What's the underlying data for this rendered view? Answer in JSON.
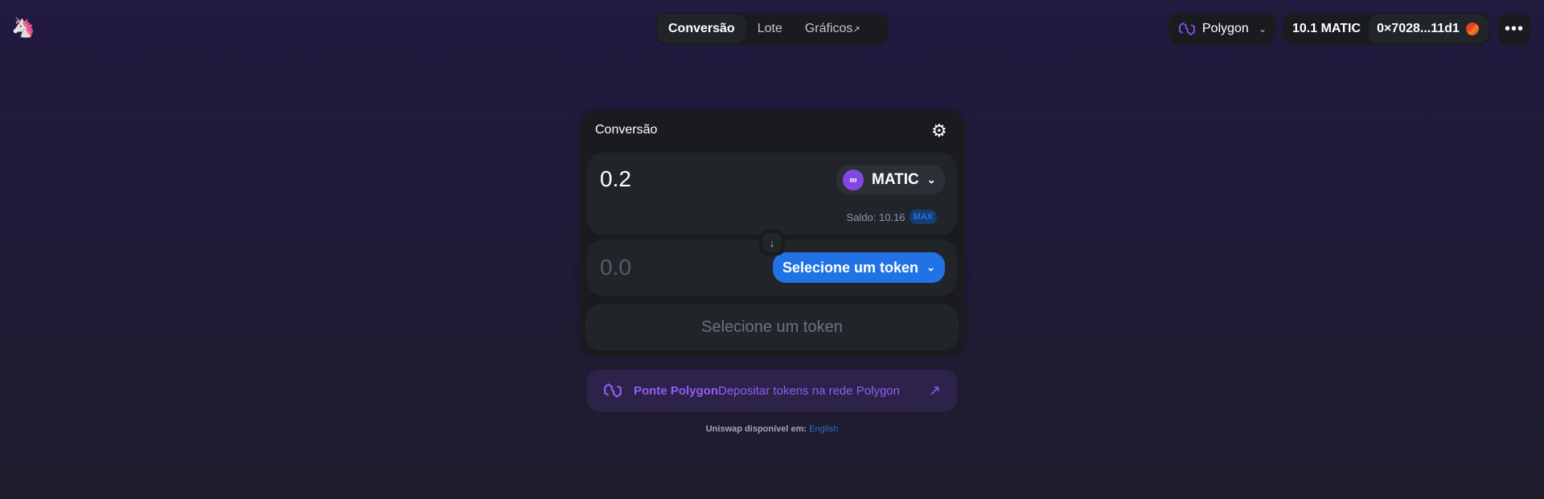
{
  "nav": {
    "tabs": [
      {
        "label": "Conversão",
        "active": true
      },
      {
        "label": "Lote"
      },
      {
        "label": "Gráficos",
        "external": "↗"
      }
    ]
  },
  "network": {
    "label": "Polygon",
    "icon": "polygon-icon"
  },
  "account": {
    "balance": "10.1 MATIC",
    "address": "0×7028...11d1"
  },
  "swap": {
    "title": "Conversão",
    "input": {
      "value": "0.2",
      "token": "MATIC",
      "balance_label": "Saldo: 10.16",
      "max": "MAX"
    },
    "output": {
      "placeholder": "0.0",
      "select_label": "Selecione um token"
    },
    "action": "Selecione um token"
  },
  "bridge": {
    "title": "Ponte Polygon",
    "description": "Depositar tokens na rede Polygon"
  },
  "footer": {
    "text": "Uniswap disponível em: ",
    "language": "English"
  },
  "colors": {
    "accent": "#2172e5",
    "polygon": "#8247e5"
  }
}
